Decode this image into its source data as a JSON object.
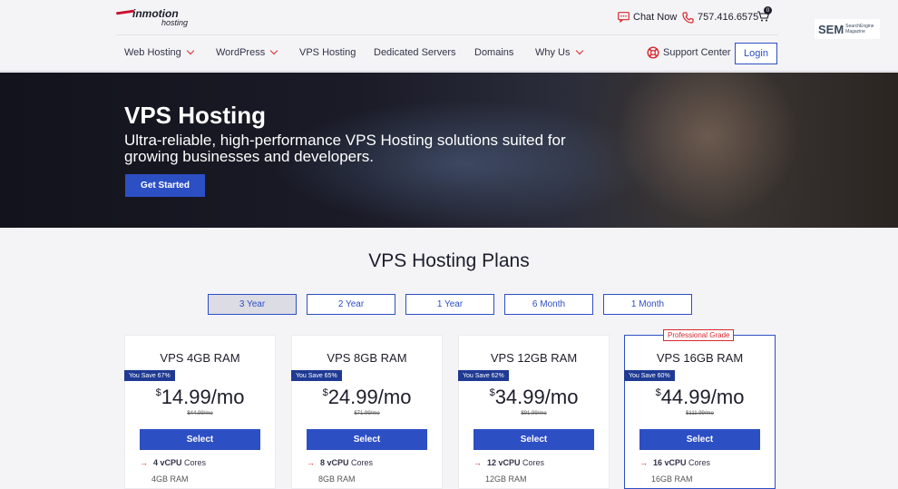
{
  "header": {
    "logo_main": "inmotion",
    "logo_sub": "hosting",
    "chat_label": "Chat Now",
    "phone": "757.416.6575",
    "cart_count": "0",
    "nav": [
      {
        "label": "Web Hosting",
        "dropdown": true
      },
      {
        "label": "WordPress",
        "dropdown": true
      },
      {
        "label": "VPS Hosting",
        "dropdown": false
      },
      {
        "label": "Dedicated Servers",
        "dropdown": false
      },
      {
        "label": "Domains",
        "dropdown": false
      },
      {
        "label": "Why Us",
        "dropdown": true
      }
    ],
    "support_label": "Support Center",
    "login_label": "Login"
  },
  "sem_badge": {
    "big": "SEM",
    "small": "SearchEngine Magazine"
  },
  "hero": {
    "title": "VPS Hosting",
    "subtitle": "Ultra-reliable, high-performance VPS Hosting solutions suited for growing businesses and developers.",
    "cta": "Get Started"
  },
  "plans": {
    "title": "VPS Hosting Plans",
    "terms": [
      {
        "label": "3 Year",
        "active": true
      },
      {
        "label": "2 Year",
        "active": false
      },
      {
        "label": "1 Year",
        "active": false
      },
      {
        "label": "6 Month",
        "active": false
      },
      {
        "label": "1 Month",
        "active": false
      }
    ],
    "featured_badge": "Professional Grade",
    "cards": [
      {
        "name": "VPS 4GB RAM",
        "save": "You Save 67%",
        "currency": "$",
        "price": "14.99",
        "per": "/mo",
        "old": "$44.99/mo",
        "select": "Select",
        "cpu_bold": "4 vCPU",
        "cpu_rest": "Cores",
        "ram": "4GB RAM"
      },
      {
        "name": "VPS 8GB RAM",
        "save": "You Save 65%",
        "currency": "$",
        "price": "24.99",
        "per": "/mo",
        "old": "$71.99/mo",
        "select": "Select",
        "cpu_bold": "8 vCPU",
        "cpu_rest": "Cores",
        "ram": "8GB RAM"
      },
      {
        "name": "VPS 12GB RAM",
        "save": "You Save 62%",
        "currency": "$",
        "price": "34.99",
        "per": "/mo",
        "old": "$91.99/mo",
        "select": "Select",
        "cpu_bold": "12 vCPU",
        "cpu_rest": "Cores",
        "ram": "12GB RAM"
      },
      {
        "name": "VPS 16GB RAM",
        "save": "You Save 60%",
        "currency": "$",
        "price": "44.99",
        "per": "/mo",
        "old": "$111.99/mo",
        "select": "Select",
        "cpu_bold": "16 vCPU",
        "cpu_rest": "Cores",
        "ram": "16GB RAM"
      }
    ]
  },
  "colors": {
    "brand_blue": "#2d4fc4",
    "accent_red": "#d9272e",
    "badge_navy": "#1f3a93"
  }
}
